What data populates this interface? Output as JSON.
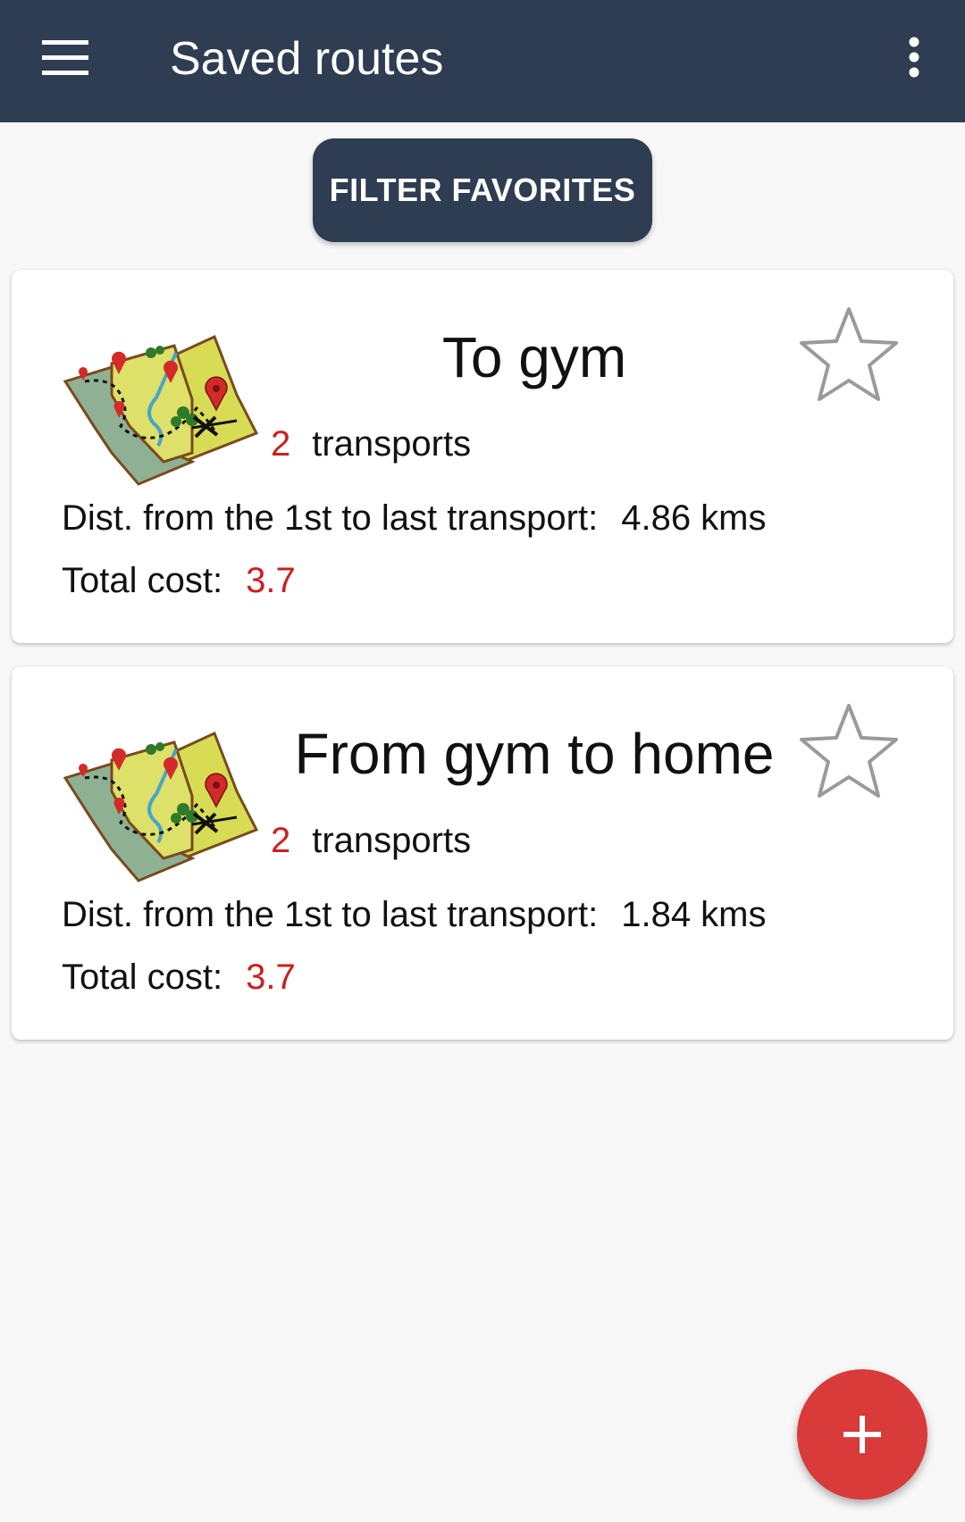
{
  "app_bar": {
    "title": "Saved routes",
    "menu_icon": "hamburger-menu-icon",
    "overflow_icon": "more-vert-icon",
    "background": "#2e3d51"
  },
  "filter": {
    "label": "FILTER FAVORITES"
  },
  "routes": [
    {
      "name": "To gym",
      "transports_count": "2",
      "transports_label": "transports",
      "distance_label": "Dist. from the 1st to last transport:",
      "distance_value": "4.86 kms",
      "cost_label": "Total cost:",
      "cost_value": "3.7",
      "favorite": false,
      "icon": "treasure-map-icon"
    },
    {
      "name": "From gym to home",
      "transports_count": "2",
      "transports_label": "transports",
      "distance_label": "Dist. from the 1st to last transport:",
      "distance_value": "1.84 kms",
      "cost_label": "Total cost:",
      "cost_value": "3.7",
      "favorite": false,
      "icon": "treasure-map-icon"
    }
  ],
  "fab": {
    "icon": "plus-icon",
    "color": "#d93a3a"
  },
  "colors": {
    "accent_red": "#cc1f1f",
    "primary_dark": "#2e3d51"
  }
}
